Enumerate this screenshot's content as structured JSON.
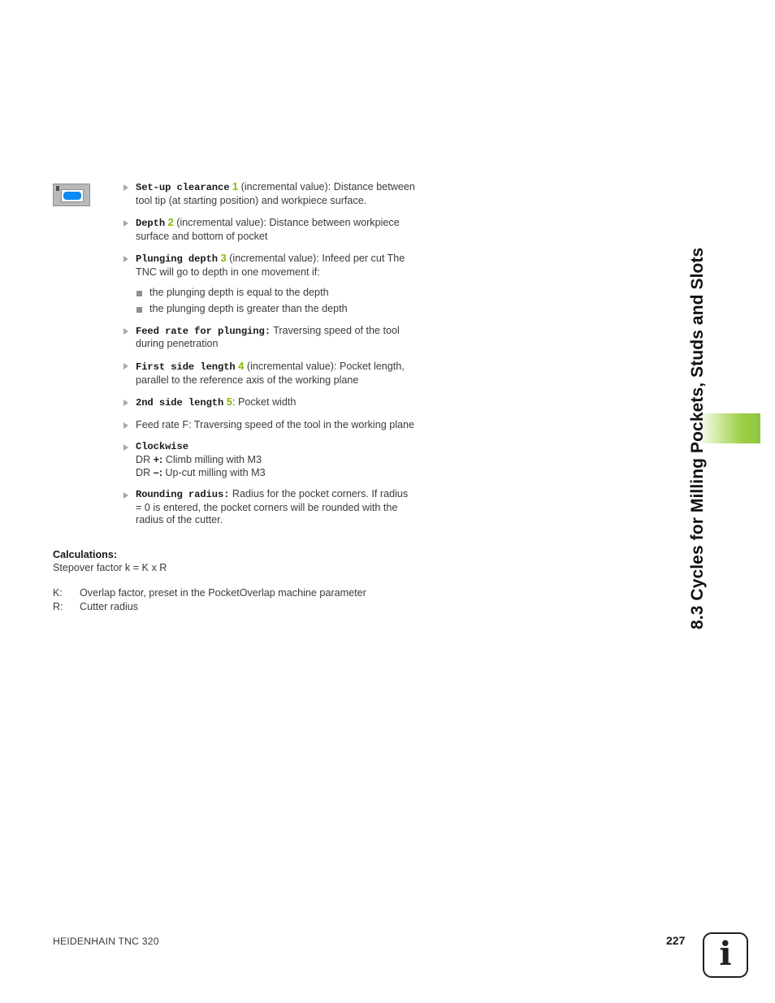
{
  "chapter": {
    "side_title": "8.3 Cycles for Milling Pockets, Studs and Slots",
    "accent_color": "#8cc63f"
  },
  "softkey_icon": {
    "name": "tnc-softkey-icon",
    "fill_color": "#0d8bf2"
  },
  "parameters": [
    {
      "term": "Set-up clearance",
      "callout": "1",
      "rest": " (incremental value): Distance between tool tip (at starting position) and workpiece surface.",
      "term_style": "mono"
    },
    {
      "term": "Depth",
      "callout": "2",
      "rest": " (incremental value): Distance between workpiece surface and bottom of pocket",
      "term_style": "mono"
    },
    {
      "term": "Plunging depth",
      "callout": "3",
      "rest": " (incremental value): Infeed per cut The TNC will go to depth in one movement if:",
      "term_style": "mono",
      "sub_items": [
        "the plunging depth is equal to the depth",
        "the plunging depth is greater than the depth"
      ]
    },
    {
      "term": "Feed rate for plunging:",
      "callout": "",
      "rest": " Traversing speed of the tool during penetration",
      "term_style": "mono"
    },
    {
      "term": "First side length",
      "callout": "4",
      "rest": " (incremental value): Pocket length, parallel to the reference axis of the working plane",
      "term_style": "mono"
    },
    {
      "term": "2nd side length",
      "callout": "5",
      "rest": ": Pocket width",
      "term_style": "mono"
    },
    {
      "term": "",
      "callout": "",
      "rest": "Feed rate F: Traversing speed of the tool in the working plane",
      "term_style": "plain"
    },
    {
      "term": "Clockwise",
      "callout": "",
      "rest": "",
      "term_style": "mono",
      "lines": [
        {
          "prefix": "DR ",
          "symbol": "+:",
          "text": " Climb milling with M3"
        },
        {
          "prefix": "DR ",
          "symbol": "–:",
          "text": " Up-cut milling with M3"
        }
      ]
    },
    {
      "term": "Rounding radius:",
      "callout": "",
      "rest": " Radius for the pocket corners. If radius = 0 is entered, the pocket corners will be rounded with the radius of the cutter.",
      "term_style": "mono"
    }
  ],
  "calculations": {
    "heading": "Calculations:",
    "formula": "Stepover factor k = K x R",
    "definitions": [
      {
        "key": "K:",
        "value": "Overlap factor, preset in the PocketOverlap machine parameter"
      },
      {
        "key": "R:",
        "value": "Cutter radius"
      }
    ]
  },
  "footer": {
    "product": "HEIDENHAIN TNC 320",
    "page_number": "227",
    "info_glyph": "i"
  }
}
